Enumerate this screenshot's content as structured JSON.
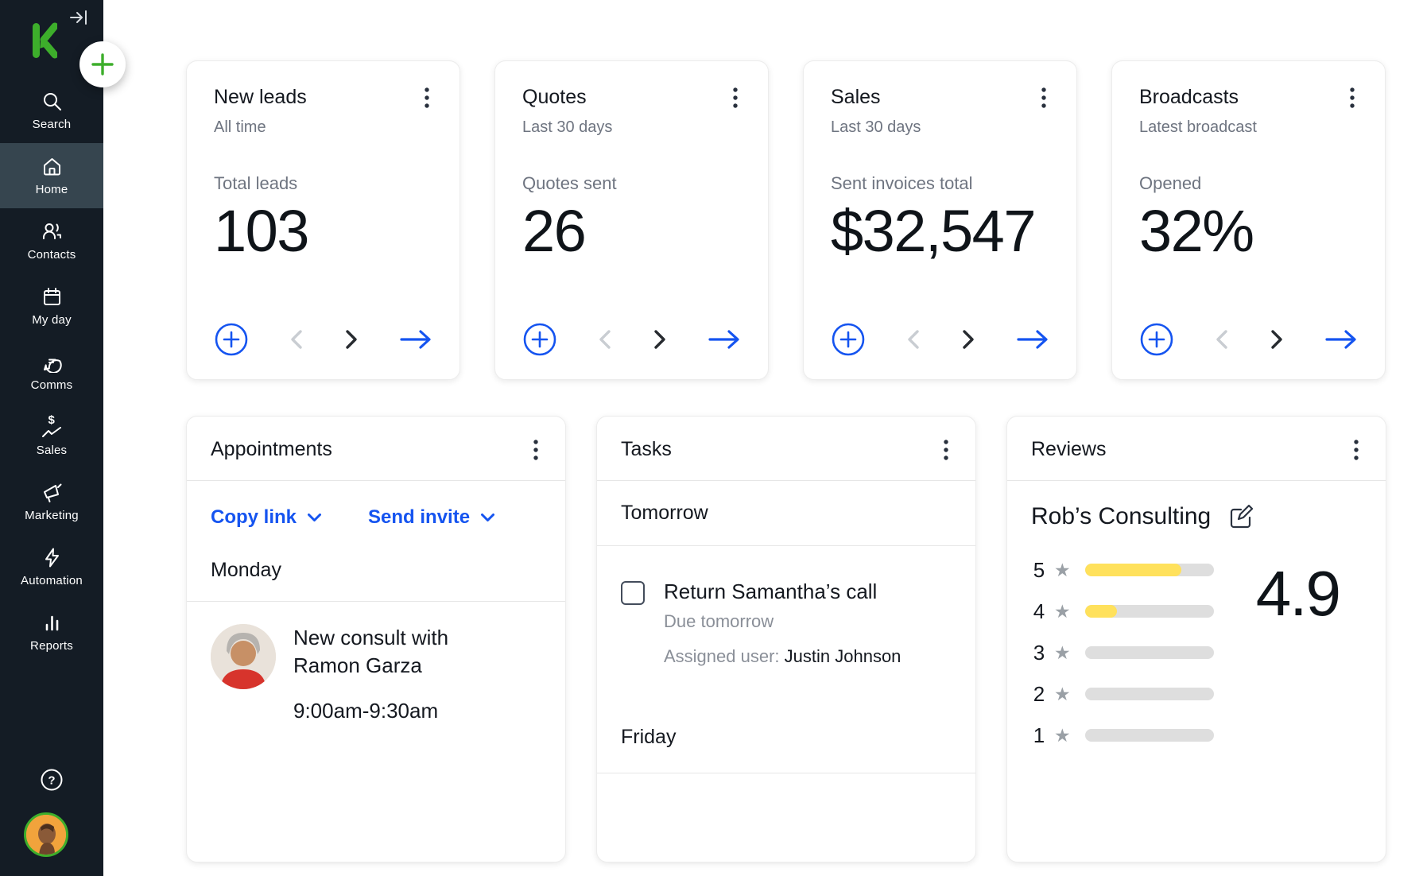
{
  "colors": {
    "sidebar_bg": "#141c25",
    "sidebar_active_bg": "#36454f",
    "brand_green": "#3dae2b",
    "accent_blue": "#1554f0",
    "text_dark": "#14181f",
    "text_gray": "#6e7480",
    "bar_yellow": "#ffe15c",
    "bar_track": "#dedede",
    "divider": "#e6e6e6"
  },
  "icons": {
    "help_glyph": "?",
    "star_glyph": "★",
    "sales_dollar_glyph": "$"
  },
  "sidebar": {
    "items": [
      {
        "label": "Search"
      },
      {
        "label": "Home",
        "active": true
      },
      {
        "label": "Contacts"
      },
      {
        "label": "My day"
      },
      {
        "label": "Comms"
      },
      {
        "label": "Sales"
      },
      {
        "label": "Marketing"
      },
      {
        "label": "Automation"
      },
      {
        "label": "Reports"
      }
    ]
  },
  "stat_cards": [
    {
      "title": "New leads",
      "subtitle": "All time",
      "metric_label": "Total leads",
      "metric_value": "103"
    },
    {
      "title": "Quotes",
      "subtitle": "Last 30 days",
      "metric_label": "Quotes sent",
      "metric_value": "26"
    },
    {
      "title": "Sales",
      "subtitle": "Last 30 days",
      "metric_label": "Sent invoices total",
      "metric_value": "$32,547"
    },
    {
      "title": "Broadcasts",
      "subtitle": "Latest broadcast",
      "metric_label": "Opened",
      "metric_value": "32%"
    }
  ],
  "appointments": {
    "title": "Appointments",
    "copy_link": "Copy link",
    "send_invite": "Send invite",
    "day": "Monday",
    "event_title": "New consult with Ramon Garza",
    "event_time": "9:00am-9:30am"
  },
  "tasks": {
    "title": "Tasks",
    "section1": "Tomorrow",
    "section2": "Friday",
    "task": {
      "title": "Return Samantha’s call",
      "due": "Due tomorrow",
      "assigned_label": "Assigned user:",
      "assigned_user": "Justin Johnson"
    }
  },
  "reviews": {
    "title": "Reviews",
    "business": "Rob’s Consulting",
    "rating": "4.9",
    "rows": [
      {
        "stars": "5",
        "percent": 75
      },
      {
        "stars": "4",
        "percent": 25
      },
      {
        "stars": "3",
        "percent": 0
      },
      {
        "stars": "2",
        "percent": 0
      },
      {
        "stars": "1",
        "percent": 0
      }
    ]
  }
}
